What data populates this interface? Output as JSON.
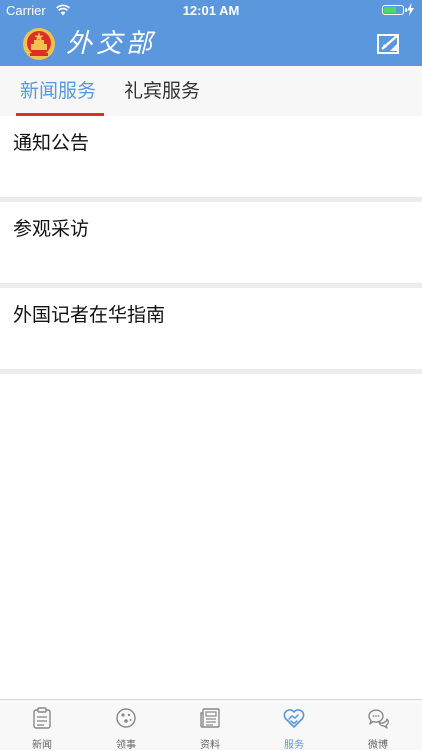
{
  "status_bar": {
    "carrier": "Carrier",
    "time": "12:01 AM",
    "battery_color": "#4cd964"
  },
  "header": {
    "logo_text": "外交部",
    "emblem_icon": "national-emblem-icon",
    "edit_icon": "compose-icon",
    "background_color": "#5b97dd"
  },
  "tabs": [
    {
      "label": "新闻服务",
      "active": true
    },
    {
      "label": "礼宾服务",
      "active": false
    }
  ],
  "tab_indicator_color": "#e02e2e",
  "list": [
    {
      "label": "通知公告"
    },
    {
      "label": "参观采访"
    },
    {
      "label": "外国记者在华指南"
    }
  ],
  "tabbar": [
    {
      "label": "新闻",
      "icon": "clipboard-icon",
      "active": false
    },
    {
      "label": "领事",
      "icon": "globe-icon",
      "active": false
    },
    {
      "label": "资料",
      "icon": "newspaper-icon",
      "active": false
    },
    {
      "label": "服务",
      "icon": "handshake-heart-icon",
      "active": true
    },
    {
      "label": "微博",
      "icon": "chat-bubbles-icon",
      "active": false
    }
  ],
  "accent_color": "#5b97dd"
}
